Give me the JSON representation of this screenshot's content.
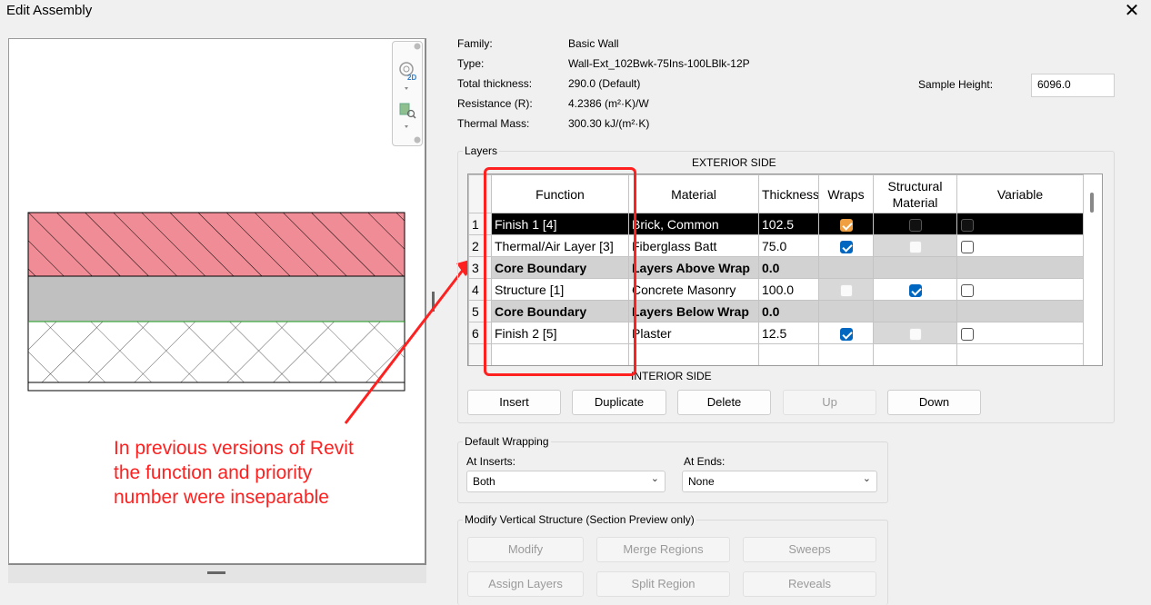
{
  "window": {
    "title": "Edit Assembly",
    "close_glyph": "✕"
  },
  "properties": {
    "family_label": "Family:",
    "family_value": "Basic Wall",
    "type_label": "Type:",
    "type_value": "Wall-Ext_102Bwk-75Ins-100LBlk-12P",
    "thickness_label": "Total thickness:",
    "thickness_value": "290.0 (Default)",
    "resistance_label": "Resistance (R):",
    "resistance_value": "4.2386 (m²·K)/W",
    "mass_label": "Thermal Mass:",
    "mass_value": "300.30 kJ/(m²·K)",
    "sample_height_label": "Sample Height:",
    "sample_height_value": "6096.0"
  },
  "layers": {
    "group_label": "Layers",
    "exterior_label": "EXTERIOR SIDE",
    "interior_label": "INTERIOR SIDE",
    "columns": [
      "Function",
      "Material",
      "Thickness",
      "Wraps",
      "Structural Material",
      "Variable"
    ],
    "rows": [
      {
        "num": "1",
        "function": "Finish 1 [4]",
        "material": "Brick, Common",
        "thickness": "102.5",
        "wraps": "orange",
        "structural": "ghostdark",
        "variable": "ghostdark",
        "style": "sel"
      },
      {
        "num": "2",
        "function": "Thermal/Air Layer [3]",
        "material": "Fiberglass Batt",
        "thickness": "75.0",
        "wraps": "on",
        "structural": "ghost",
        "variable": "off",
        "style": ""
      },
      {
        "num": "3",
        "function": "Core Boundary",
        "material": "Layers Above Wrap",
        "thickness": "0.0",
        "wraps": "",
        "structural": "",
        "variable": "",
        "style": "grey"
      },
      {
        "num": "4",
        "function": "Structure [1]",
        "material": "Concrete Masonry",
        "thickness": "100.0",
        "wraps": "ghost",
        "structural": "on",
        "variable": "off",
        "style": ""
      },
      {
        "num": "5",
        "function": "Core Boundary",
        "material": "Layers Below Wrap",
        "thickness": "0.0",
        "wraps": "",
        "structural": "",
        "variable": "",
        "style": "grey"
      },
      {
        "num": "6",
        "function": "Finish 2 [5]",
        "material": "Plaster",
        "thickness": "12.5",
        "wraps": "on",
        "structural": "ghost",
        "variable": "off",
        "style": ""
      }
    ],
    "buttons": {
      "insert": "Insert",
      "duplicate": "Duplicate",
      "delete": "Delete",
      "up": "Up",
      "down": "Down"
    }
  },
  "wrapping": {
    "group_label": "Default Wrapping",
    "inserts_label": "At Inserts:",
    "inserts_value": "Both",
    "ends_label": "At  Ends:",
    "ends_value": "None"
  },
  "vertical": {
    "group_label": "Modify Vertical Structure (Section Preview only)",
    "modify": "Modify",
    "merge": "Merge Regions",
    "sweeps": "Sweeps",
    "assign": "Assign Layers",
    "split": "Split Region",
    "reveals": "Reveals"
  },
  "annotation": {
    "text": "In previous versions of Revit the function and priority number were inseparable",
    "color": "#ff2020"
  },
  "colors": {
    "brick": "#f08c96",
    "concrete": "#c0c0c0",
    "selection": "#000000",
    "checkbox_on": "#0067c0"
  }
}
